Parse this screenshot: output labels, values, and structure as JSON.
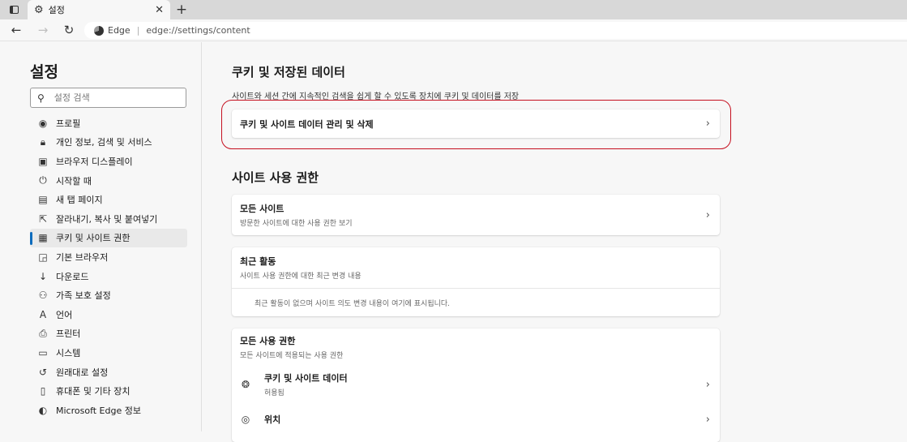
{
  "tab": {
    "title": "설정",
    "icon": "gear-icon"
  },
  "address": {
    "site": "Edge",
    "url": "edge://settings/content"
  },
  "sidebar": {
    "title": "설정",
    "search_placeholder": "설정 검색",
    "items": [
      {
        "label": "프로필",
        "icon": "profile-icon"
      },
      {
        "label": "개인 정보, 검색 및 서비스",
        "icon": "lock-icon"
      },
      {
        "label": "브라우저 디스플레이",
        "icon": "appearance-icon"
      },
      {
        "label": "시작할 때",
        "icon": "power-icon"
      },
      {
        "label": "새 탭 페이지",
        "icon": "new-tab-icon"
      },
      {
        "label": "잘라내기, 복사 및 붙여넣기",
        "icon": "share-icon"
      },
      {
        "label": "쿠키 및 사이트 권한",
        "icon": "site-permissions-icon",
        "active": true
      },
      {
        "label": "기본 브라우저",
        "icon": "default-browser-icon"
      },
      {
        "label": "다운로드",
        "icon": "download-icon"
      },
      {
        "label": "가족 보호 설정",
        "icon": "family-icon"
      },
      {
        "label": "언어",
        "icon": "language-icon"
      },
      {
        "label": "프린터",
        "icon": "printer-icon"
      },
      {
        "label": "시스템",
        "icon": "system-icon"
      },
      {
        "label": "원래대로 설정",
        "icon": "reset-icon"
      },
      {
        "label": "휴대폰 및 기타 장치",
        "icon": "phone-icon"
      },
      {
        "label": "Microsoft Edge 정보",
        "icon": "edge-icon"
      }
    ]
  },
  "main": {
    "cookies_section": {
      "title": "쿠키 및 저장된 데이터",
      "description": "사이트와 세션 간에 지속적인 검색을 쉽게 할 수 있도록 장치에 쿠키 및 데이터를 저장",
      "manage_label": "쿠키 및 사이트 데이터 관리 및 삭제"
    },
    "permissions_section": {
      "title": "사이트 사용 권한",
      "all_sites": {
        "title": "모든 사이트",
        "subtitle": "방문한 사이트에 대한 사용 권한 보기"
      },
      "recent": {
        "title": "최근 활동",
        "subtitle": "사이트 사용 권한에 대한 최근 변경 내용",
        "empty": "최근 활동이 없으며 사이트 의도 변경 내용이 여기에 표시됩니다."
      },
      "all_permissions": {
        "title": "모든 사용 권한",
        "subtitle": "모든 사이트에 적용되는 사용 권한",
        "items": [
          {
            "label": "쿠키 및 사이트 데이터",
            "status": "허용됨",
            "icon": "cookie-icon"
          },
          {
            "label": "위치",
            "status": "",
            "icon": "location-icon"
          }
        ]
      }
    }
  },
  "colors": {
    "accent": "#0f6cbd",
    "highlight": "#c50f1f"
  }
}
